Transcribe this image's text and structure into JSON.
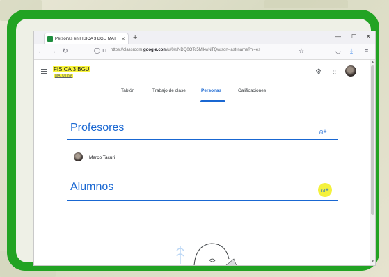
{
  "browser": {
    "tab_title": "Personas en FISICA 3 BGU MAT",
    "tab_close": "✕",
    "new_tab": "+",
    "minimize": "—",
    "maximize": "☐",
    "close": "✕",
    "url_prefix": "https://classroom.",
    "url_domain": "google.com",
    "url_rest": "/u/0/r/NDQ0OTc5MjkwNTQw/sort-last-name?hl=es"
  },
  "app": {
    "course_title": "FISICA 3 BGU",
    "course_section": "MATUTINA",
    "tabs": [
      {
        "label": "Tablón"
      },
      {
        "label": "Trabajo de clase"
      },
      {
        "label": "Personas"
      },
      {
        "label": "Calificaciones"
      }
    ],
    "active_tab": "Personas"
  },
  "teachers": {
    "heading": "Profesores",
    "people": [
      {
        "name": "Marco Tacuri"
      }
    ]
  },
  "students": {
    "heading": "Alumnos"
  },
  "colors": {
    "frame": "#22a323",
    "accent": "#1967d2",
    "highlight": "#f8f43a"
  },
  "icons": [
    "menu-icon",
    "settings-icon",
    "apps-icon",
    "add-person-icon",
    "help-icon",
    "back-icon",
    "forward-icon",
    "reload-icon",
    "shield-icon",
    "lock-icon",
    "star-icon",
    "pocket-icon",
    "download-icon",
    "hamburger-icon"
  ]
}
